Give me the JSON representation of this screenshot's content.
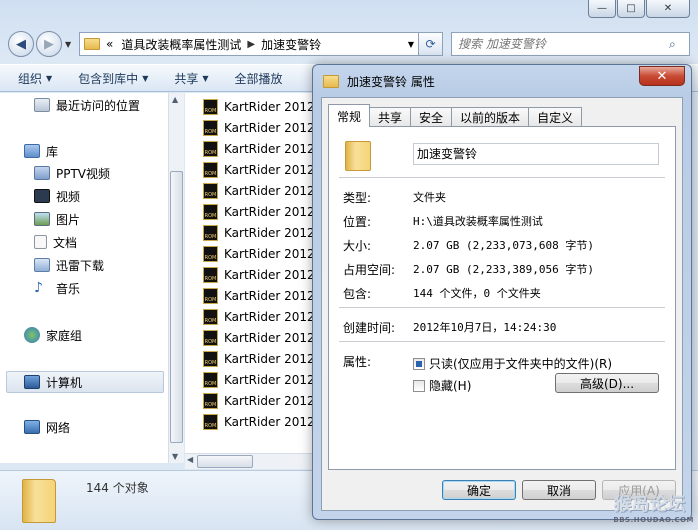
{
  "explorer": {
    "window_controls": {
      "minimize": "—",
      "maximize": "□",
      "close": "✕"
    },
    "address": {
      "prefix": "«",
      "crumbs": [
        "道具改装概率属性测试",
        "加速变警铃"
      ]
    },
    "search": {
      "placeholder": "搜索 加速变警铃"
    },
    "toolbar": [
      "组织",
      "包含到库中",
      "共享",
      "全部播放"
    ],
    "sidebar": {
      "items": [
        {
          "label": "最近访问的位置",
          "icon": "recent-places-icon",
          "group": false
        },
        {
          "label": "库",
          "icon": "library-icon",
          "group": true
        },
        {
          "label": "PPTV视频",
          "icon": "video-library-icon",
          "group": false
        },
        {
          "label": "视频",
          "icon": "video-icon",
          "group": false
        },
        {
          "label": "图片",
          "icon": "pictures-icon",
          "group": false
        },
        {
          "label": "文档",
          "icon": "documents-icon",
          "group": false
        },
        {
          "label": "迅雷下载",
          "icon": "download-icon",
          "group": false
        },
        {
          "label": "音乐",
          "icon": "music-icon",
          "group": false
        },
        {
          "label": "家庭组",
          "icon": "homegroup-icon",
          "group": true
        },
        {
          "label": "计算机",
          "icon": "computer-icon",
          "group": true
        },
        {
          "label": "网络",
          "icon": "network-icon",
          "group": true
        }
      ]
    },
    "files": [
      "KartRider 2012-",
      "KartRider 2012-",
      "KartRider 2012-",
      "KartRider 2012-",
      "KartRider 2012-",
      "KartRider 2012-",
      "KartRider 2012-",
      "KartRider 2012-",
      "KartRider 2012-",
      "KartRider 2012-",
      "KartRider 2012-",
      "KartRider 2012-",
      "KartRider 2012-",
      "KartRider 2012-",
      "KartRider 2012-",
      "KartRider 2012-"
    ],
    "status": {
      "object_count": "144 个对象"
    }
  },
  "dialog": {
    "title": "加速变警铃 属性",
    "close": "✕",
    "tabs": [
      "常规",
      "共享",
      "安全",
      "以前的版本",
      "自定义"
    ],
    "active_tab": 0,
    "name": "加速变警铃",
    "props": {
      "type": {
        "label": "类型:",
        "value": "文件夹"
      },
      "location": {
        "label": "位置:",
        "value": "H:\\道具改装概率属性测试"
      },
      "size": {
        "label": "大小:",
        "value": "2.07 GB (2,233,073,608 字节)"
      },
      "size_on_disk": {
        "label": "占用空间:",
        "value": "2.07 GB (2,233,389,056 字节)"
      },
      "contains": {
        "label": "包含:",
        "value": "144 个文件，0 个文件夹"
      },
      "created": {
        "label": "创建时间:",
        "value": "2012年10月7日，14:24:30"
      },
      "attributes": {
        "label": "属性:"
      }
    },
    "attributes": {
      "readonly": {
        "label": "只读(仅应用于文件夹中的文件)(R)",
        "state": "indeterminate"
      },
      "hidden": {
        "label": "隐藏(H)",
        "state": "unchecked"
      },
      "advanced_button": "高级(D)..."
    },
    "buttons": {
      "ok": "确定",
      "cancel": "取消",
      "apply": "应用(A)"
    }
  },
  "watermark": {
    "text": "猴岛论坛",
    "url": "BBS.HOUDAO.COM"
  }
}
